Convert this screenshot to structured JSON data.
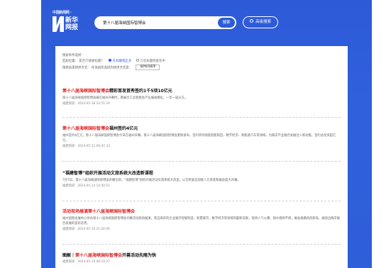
{
  "colors": {
    "brand_blue": "#2d5bd8",
    "highlight_red": "#e02020"
  },
  "header": {
    "logo_small": "中国新闻网 ·",
    "logo_line1": "新华",
    "logo_line2": "网报",
    "search_value": "第十八届海峡国际智博会",
    "search_button": "搜索",
    "advanced_button": "高级搜索",
    "advanced_icon": "search-icon"
  },
  "filters": {
    "row1": {
      "label": "搜索条件选择：",
      "text": ""
    },
    "row2": {
      "label": "匹配位置：",
      "lead": "是否只搜索标题？",
      "opt1": "在标题或正文",
      "opt2": "只在标题检索名中"
    },
    "row3": {
      "label": "搜索结果排序方式：",
      "lead": "你当前所选择的排序方式是：",
      "select_value": "按时间排序"
    }
  },
  "results": [
    {
      "title_highlight": "第十八届海峡国际智博会",
      "title_rest": "精彩首发首秀签约1千5项10亿元",
      "snippet": "第十八届海峡国际智博会展在福州开幕时，看展示工业智能生产业展规模化，一年一届分方。",
      "meta_label": "福建频道",
      "meta_time": "2024-05-18 10:51:20"
    },
    {
      "title_highlight": "第十八届海峡国际智博会",
      "title_rest": "福州签约4亿元",
      "snippet": "福州签约4亿元，第十八届海峡国际智博会今日在福州开幕。第十八届海峡国际智博会重磅发布，签约项目涵盖智能制造、数字经济、新能源汽车等领域，为两岸产业融合发展注入新动能，签约总投资超亿元。",
      "meta_label": "福建频道",
      "meta_time": "2024-05-12 06:47:33"
    },
    {
      "title_highlight": "",
      "title_rest": "“福建智博”组织开展活动文旅系统大改造新课程",
      "snippet": "7月7日，第十八届海峡国际智博会开幕在即，“福建智博”组织开展活动文旅系统大改造，以全新姿态迎接八方来客和展会盛大开幕。",
      "meta_label": "福建频道",
      "meta_time": "2024-05-14 14:50:51"
    },
    {
      "title_highlight": "第十八届海峡国际智博会",
      "title_prefix": "活动现场展演",
      "title_rest": "",
      "snippet": "福州国际会展中心举办第十八届海峡国际智博会开幕活动现场展演，来自两岸的企业展示智能制造、智慧城市、数字经济等领域的最新成果，现场人气火爆，观众络绎不绝，展会规模再创新高，展现出两岸融合发展的良好态势。",
      "meta_label": "福建频道",
      "meta_time": "2024-05-14 21:26:00"
    },
    {
      "title_prefix": "图解｜",
      "title_highlight": "第十八届海峡国际智博会",
      "title_rest": "开幕活动先睹为快",
      "snippet": "",
      "meta_label": "福建频道",
      "meta_time": "2024-05-14 08:19:27"
    }
  ]
}
